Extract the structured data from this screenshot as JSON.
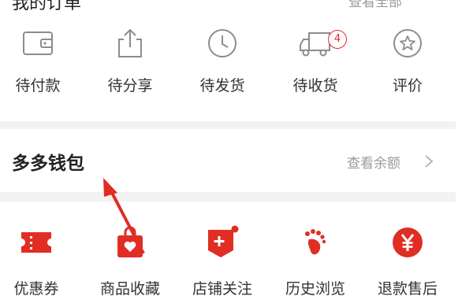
{
  "orders": {
    "title": "我的订单",
    "more_label": "查看全部",
    "items": [
      {
        "label": "待付款",
        "icon": "wallet-icon"
      },
      {
        "label": "待分享",
        "icon": "share-icon"
      },
      {
        "label": "待发货",
        "icon": "clock-icon"
      },
      {
        "label": "待收货",
        "icon": "truck-icon",
        "badge": "4"
      },
      {
        "label": "评价",
        "icon": "star-review-icon"
      }
    ]
  },
  "wallet": {
    "title": "多多钱包",
    "link": "查看余额"
  },
  "services": {
    "items": [
      {
        "label": "优惠券",
        "icon": "coupon-icon"
      },
      {
        "label": "商品收藏",
        "icon": "heart-bag-icon"
      },
      {
        "label": "店铺关注",
        "icon": "store-plus-icon"
      },
      {
        "label": "历史浏览",
        "icon": "footprint-icon"
      },
      {
        "label": "退款售后",
        "icon": "yen-icon"
      }
    ]
  },
  "colors": {
    "accent": "#e02e24",
    "icon_gray": "#8c8c8c",
    "separator": "#f2f2f2"
  }
}
